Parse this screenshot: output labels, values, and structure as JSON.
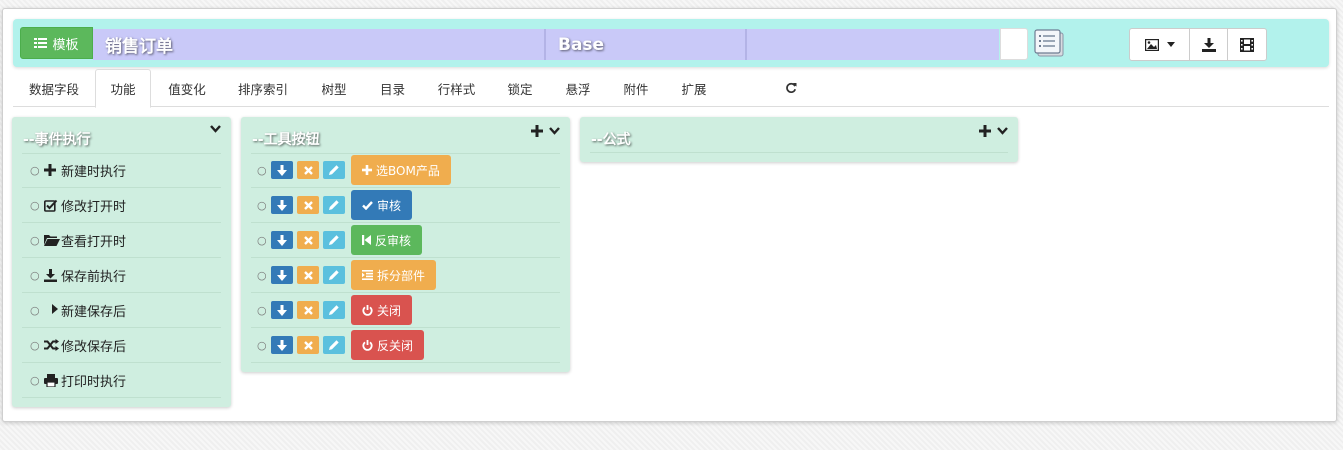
{
  "header": {
    "template_label": "模板",
    "title_segments": [
      "销售订单",
      "Base",
      ""
    ]
  },
  "tabs": [
    {
      "label": "数据字段",
      "active": false
    },
    {
      "label": "功能",
      "active": true
    },
    {
      "label": "值变化",
      "active": false
    },
    {
      "label": "排序索引",
      "active": false
    },
    {
      "label": "树型",
      "active": false
    },
    {
      "label": "目录",
      "active": false
    },
    {
      "label": "行样式",
      "active": false
    },
    {
      "label": "锁定",
      "active": false
    },
    {
      "label": "悬浮",
      "active": false
    },
    {
      "label": "附件",
      "active": false
    },
    {
      "label": "扩展",
      "active": false
    }
  ],
  "panels": {
    "events": {
      "title": "--事件执行",
      "items": [
        {
          "label": "新建时执行",
          "icon": "plus-icon"
        },
        {
          "label": "修改打开时",
          "icon": "edit-icon"
        },
        {
          "label": "查看打开时",
          "icon": "folder-open-icon"
        },
        {
          "label": "保存前执行",
          "icon": "download-icon"
        },
        {
          "label": "新建保存后",
          "icon": "share-icon"
        },
        {
          "label": "修改保存后",
          "icon": "shuffle-icon"
        },
        {
          "label": "打印时执行",
          "icon": "print-icon"
        }
      ]
    },
    "toolbar_buttons": {
      "title": "--工具按钮",
      "items": [
        {
          "label": "选BOM产品",
          "icon": "plus-icon",
          "style": "warning",
          "color": "#f0ad4e"
        },
        {
          "label": "审核",
          "icon": "check-icon",
          "style": "primary",
          "color": "#337ab7"
        },
        {
          "label": "反审核",
          "icon": "step-backward-icon",
          "style": "success",
          "color": "#5cb85c"
        },
        {
          "label": "拆分部件",
          "icon": "indent-icon",
          "style": "warning",
          "color": "#f0ad4e"
        },
        {
          "label": "关闭",
          "icon": "power-icon",
          "style": "danger",
          "color": "#d9534f"
        },
        {
          "label": "反关闭",
          "icon": "power-icon",
          "style": "danger",
          "color": "#d9534f"
        }
      ]
    },
    "formula": {
      "title": "--公式"
    }
  },
  "colors": {
    "header_bg": "#b2f2ec",
    "title_strip": "#c9c9f8",
    "panel_bg": "#cfeee0",
    "success": "#5cb85c",
    "primary": "#337ab7",
    "warning": "#f0ad4e",
    "info": "#5bc0de",
    "danger": "#d9534f"
  }
}
